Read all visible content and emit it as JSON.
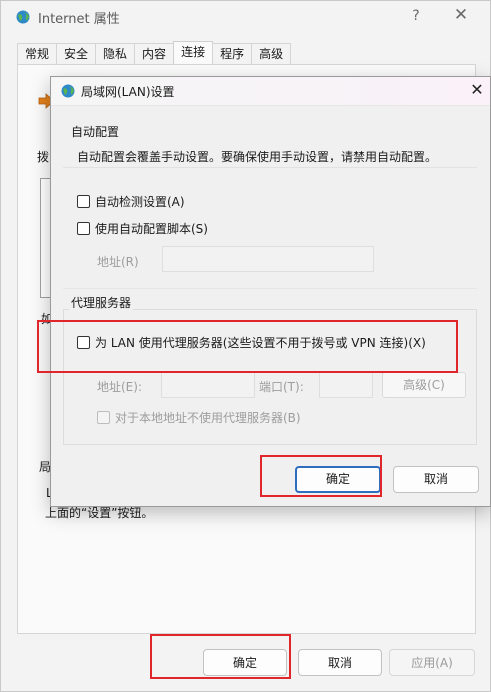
{
  "parent": {
    "title": "Internet 属性",
    "help_glyph": "?",
    "close_glyph": "✕",
    "tabs": [
      {
        "label": "常规"
      },
      {
        "label": "安全"
      },
      {
        "label": "隐私"
      },
      {
        "label": "内容"
      },
      {
        "label": "连接"
      },
      {
        "label": "程序"
      },
      {
        "label": "高级"
      }
    ],
    "active_tab": "连接",
    "behind": {
      "frag_dial": "拨",
      "frag_ru": "如",
      "frag_lan": "局",
      "frag_l": "L",
      "frag_line": "上面的“设置”按钮。"
    },
    "buttons": {
      "ok": "确定",
      "cancel": "取消",
      "apply": "应用(A)"
    }
  },
  "lan_dialog": {
    "title": "局域网(LAN)设置",
    "close_glyph": "✕",
    "auto_config": {
      "group_title": "自动配置",
      "description": "自动配置会覆盖手动设置。要确保使用手动设置，请禁用自动配置。",
      "auto_detect": {
        "label": "自动检测设置(A)",
        "checked": false
      },
      "use_script": {
        "label": "使用自动配置脚本(S)",
        "checked": false
      },
      "address_label": "地址(R)",
      "address_value": ""
    },
    "proxy": {
      "group_title": "代理服务器",
      "use_proxy": {
        "label": "为 LAN 使用代理服务器(这些设置不用于拨号或 VPN 连接)(X)",
        "checked": false
      },
      "address_label": "地址(E):",
      "address_value": "",
      "port_label": "端口(T):",
      "port_value": "",
      "advanced_button": "高级(C)",
      "bypass_local": {
        "label": "对于本地地址不使用代理服务器(B)",
        "checked": false
      }
    },
    "buttons": {
      "ok": "确定",
      "cancel": "取消"
    }
  },
  "colors": {
    "annotation": "#e0262b",
    "default_button_border": "#2f6dbf",
    "disabled_text": "#9d9d9d"
  }
}
